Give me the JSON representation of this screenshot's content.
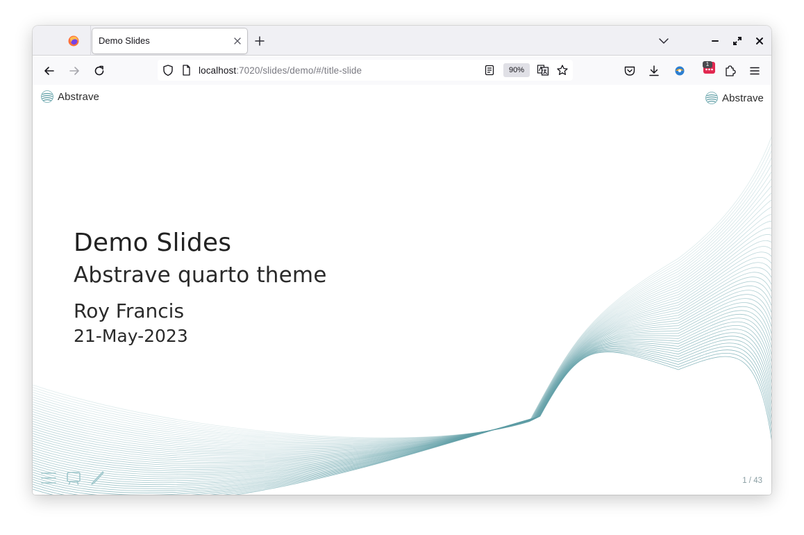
{
  "browser": {
    "tab_title": "Demo Slides",
    "url_host": "localhost",
    "url_rest": ":7020/slides/demo/#/title-slide",
    "zoom_level": "90%",
    "extension_badge_count": "1",
    "icons": [
      "firefox-logo-icon",
      "close-icon",
      "plus-icon",
      "chevron-down-icon",
      "minimize-icon",
      "maximize-icon",
      "close-window-icon",
      "back-arrow-icon",
      "forward-arrow-icon",
      "reload-icon",
      "shield-icon",
      "page-icon",
      "reader-view-icon",
      "translate-icon",
      "star-icon",
      "pocket-icon",
      "download-icon",
      "extension-icon",
      "puzzle-icon",
      "hamburger-menu-icon"
    ]
  },
  "slide": {
    "logo_left_text": "Abstrave",
    "logo_right_text": "Abstrave",
    "title": "Demo Slides",
    "subtitle": "Abstrave quarto theme",
    "author": "Roy Francis",
    "date": "21-May-2023",
    "slide_number": "1 / 43",
    "accent_color": "#5f9ea6",
    "controls": [
      "menu-icon",
      "chalkboard-icon",
      "pen-icon"
    ]
  }
}
